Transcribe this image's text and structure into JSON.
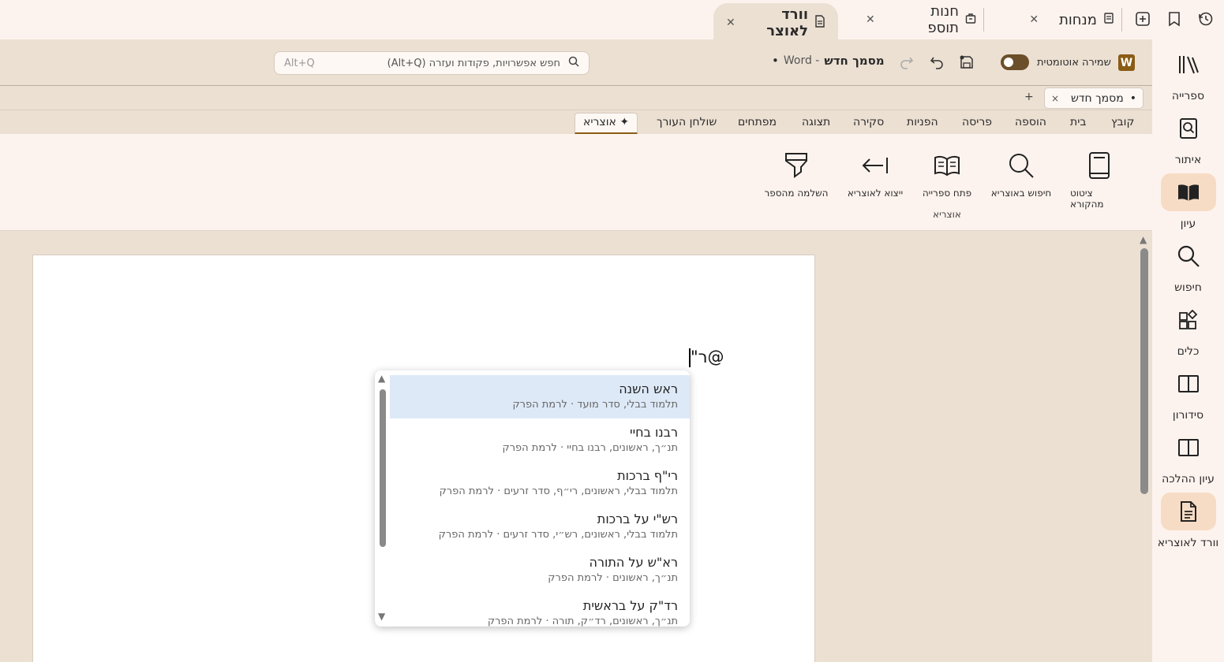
{
  "tabs": [
    {
      "label": "וורד לאוצר",
      "icon": "document-icon",
      "active": true
    },
    {
      "label": "חנות תוספ",
      "icon": "store-icon",
      "active": false
    },
    {
      "label": "מנחות",
      "icon": "book-icon",
      "active": false
    }
  ],
  "sidebar": {
    "items": [
      {
        "label": "ספרייה",
        "icon": "library-icon"
      },
      {
        "label": "איתור",
        "icon": "locate-icon"
      },
      {
        "label": "עיון",
        "icon": "open-book-icon"
      },
      {
        "label": "חיפוש",
        "icon": "search-icon"
      },
      {
        "label": "כלים",
        "icon": "tools-icon"
      },
      {
        "label": "סידורון",
        "icon": "siddur-icon"
      },
      {
        "label": "עיון ההלכה",
        "icon": "halacha-icon"
      },
      {
        "label": "וורד לאוצריא",
        "icon": "word-doc-icon"
      }
    ]
  },
  "cmdrow": {
    "search_placeholder": "חפש אפשרויות, פקודות ועזרה (Alt+Q)",
    "search_shortcut": "Alt+Q",
    "doc_name": "מסמך חדש",
    "app_name": "- Word",
    "dot": "•",
    "autosave_label": "שמירה אוטומטית",
    "word_logo": "W"
  },
  "doctab": {
    "label": "מסמך חדש",
    "dot": "•",
    "close": "×",
    "add": "+"
  },
  "ribbon_tabs": [
    "קובץ",
    "בית",
    "הוספה",
    "פריסה",
    "הפניות",
    "סקירה",
    "תצוגה",
    "מפתחים",
    "שולחן העורך",
    "אוצריא"
  ],
  "ribbon_active_tab_label": "✦ אוצריא",
  "ribbon": {
    "buttons": [
      {
        "label": "ציטוט מהקורא",
        "icon": "quote-book-icon"
      },
      {
        "label": "חיפוש באוצריא",
        "icon": "search-icon"
      },
      {
        "label": "פתח ספרייה",
        "icon": "open-library-icon"
      },
      {
        "label": "ייצוא לאוצריא",
        "icon": "export-arrow-icon"
      },
      {
        "label": "השלמה מהספר",
        "icon": "highlighter-icon"
      }
    ],
    "group_label": "אוצריא"
  },
  "document": {
    "typed_text": "@ר\""
  },
  "suggestions": [
    {
      "title": "ראש השנה",
      "subtitle": "תלמוד בבלי, סדר מועד · לרמת הפרק",
      "highlighted": true
    },
    {
      "title": "רבנו בחיי",
      "subtitle": "תנ״ך, ראשונים, רבנו בחיי · לרמת הפרק",
      "highlighted": false
    },
    {
      "title": "רי\"ף ברכות",
      "subtitle": "תלמוד בבלי, ראשונים, רי״ף, סדר זרעים · לרמת הפרק",
      "highlighted": false
    },
    {
      "title": "רש\"י על ברכות",
      "subtitle": "תלמוד בבלי, ראשונים, רש״י, סדר זרעים · לרמת הפרק",
      "highlighted": false
    },
    {
      "title": "רא\"ש על התורה",
      "subtitle": "תנ״ך, ראשונים · לרמת הפרק",
      "highlighted": false
    },
    {
      "title": "רד\"ק על בראשית",
      "subtitle": "תנ״ך, ראשונים, רד״ק, תורה · לרמת הפרק",
      "highlighted": false
    }
  ],
  "colors": {
    "accent": "#8a5c14",
    "highlight": "#dde9f7",
    "background": "#ece0d3",
    "panel": "#fdf3ee"
  }
}
